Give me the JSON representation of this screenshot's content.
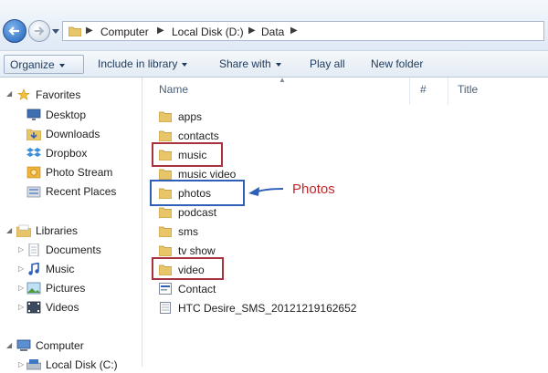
{
  "address": {
    "crumbs": [
      "Computer",
      "Local Disk (D:)",
      "Data"
    ]
  },
  "toolbar": {
    "organize": "Organize",
    "include_in_library": "Include in library",
    "share_with": "Share with",
    "play_all": "Play all",
    "new_folder": "New folder"
  },
  "nav": {
    "favorites": {
      "label": "Favorites",
      "items": [
        "Desktop",
        "Downloads",
        "Dropbox",
        "Photo Stream",
        "Recent Places"
      ]
    },
    "libraries": {
      "label": "Libraries",
      "items": [
        "Documents",
        "Music",
        "Pictures",
        "Videos"
      ]
    },
    "computer": {
      "label": "Computer",
      "items": [
        "Local Disk (C:)"
      ]
    }
  },
  "columns": {
    "name": "Name",
    "number": "#",
    "title": "Title"
  },
  "files": [
    {
      "name": "apps",
      "type": "folder"
    },
    {
      "name": "contacts",
      "type": "folder"
    },
    {
      "name": "music",
      "type": "folder",
      "highlight": "red"
    },
    {
      "name": "music video",
      "type": "folder"
    },
    {
      "name": "photos",
      "type": "folder",
      "highlight": "blue"
    },
    {
      "name": "podcast",
      "type": "folder"
    },
    {
      "name": "sms",
      "type": "folder"
    },
    {
      "name": "tv show",
      "type": "folder"
    },
    {
      "name": "video",
      "type": "folder",
      "highlight": "red"
    },
    {
      "name": "Contact",
      "type": "contact-file"
    },
    {
      "name": "HTC Desire_SMS_20121219162652",
      "type": "document-file"
    }
  ],
  "annotation": {
    "text": "Photos",
    "color": "#c0272d",
    "arrow_color": "#2f5fb9"
  },
  "colors": {
    "red_box": "#a8323e",
    "blue_box": "#2f5fb9",
    "folder": "#e9c56a"
  }
}
